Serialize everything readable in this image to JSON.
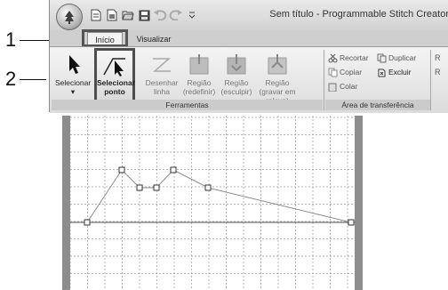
{
  "callouts": [
    {
      "number": "1"
    },
    {
      "number": "2"
    }
  ],
  "titlebar": {
    "title": "Sem título - Programmable Stitch Creator",
    "quick_access": [
      "new-icon",
      "new-template-icon",
      "open-icon",
      "save-icon",
      "undo-icon",
      "redo-icon",
      "customize-icon"
    ]
  },
  "tabs": [
    {
      "label": "Início",
      "active": true
    },
    {
      "label": "Visualizar",
      "active": false
    }
  ],
  "ribbon": {
    "ferramentas": {
      "group_label": "Ferramentas",
      "buttons": [
        {
          "label": "Selecionar",
          "sub": "▾",
          "icon": "arrow-cursor-icon",
          "enabled": true
        },
        {
          "label": "Selecionar ponto",
          "icon": "select-point-icon",
          "enabled": true,
          "selected": true
        },
        {
          "label": "Desenhar linha",
          "icon": "draw-line-icon",
          "enabled": false
        },
        {
          "label": "Região (redefinir)",
          "icon": "region-reset-icon",
          "enabled": false
        },
        {
          "label": "Região (esculpir)",
          "icon": "region-sculpt-icon",
          "enabled": false
        },
        {
          "label": "Região (gravar em relevo)",
          "icon": "region-emboss-icon",
          "enabled": false
        }
      ]
    },
    "clipboard": {
      "group_label": "Área de transferência",
      "buttons": [
        {
          "label": "Recortar",
          "icon": "scissors-icon"
        },
        {
          "label": "Duplicar",
          "icon": "duplicate-icon"
        },
        {
          "label": "Copiar",
          "icon": "copy-icon"
        },
        {
          "label": "Excluir",
          "icon": "delete-icon"
        },
        {
          "label": "Colar",
          "icon": "paste-icon"
        }
      ]
    }
  },
  "colors": {
    "window_bg": "#dcdcdc",
    "grid_line": "#9a9a9a",
    "stitch_line": "#8c8c8c",
    "rail": "#8d8d8d"
  }
}
